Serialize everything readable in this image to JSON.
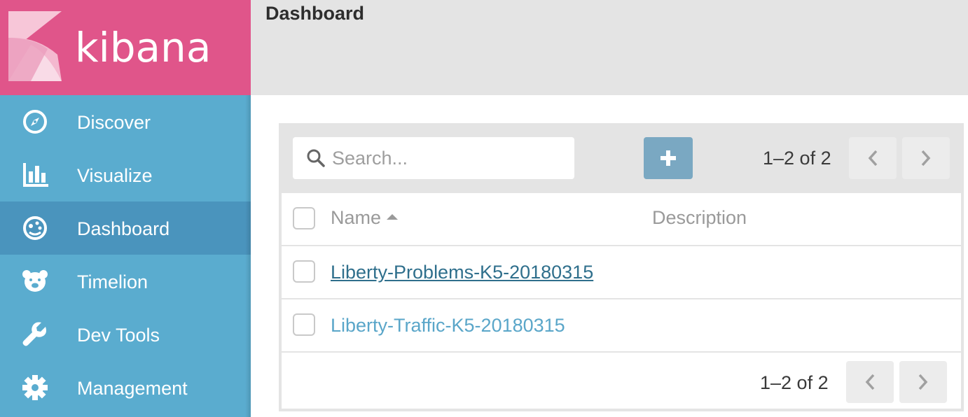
{
  "brand": {
    "name": "kibana"
  },
  "sidebar": {
    "items": [
      {
        "label": "Discover",
        "icon": "compass-icon",
        "active": false
      },
      {
        "label": "Visualize",
        "icon": "bar-chart-icon",
        "active": false
      },
      {
        "label": "Dashboard",
        "icon": "dashboard-gauge-icon",
        "active": true
      },
      {
        "label": "Timelion",
        "icon": "bear-icon",
        "active": false
      },
      {
        "label": "Dev Tools",
        "icon": "wrench-icon",
        "active": false
      },
      {
        "label": "Management",
        "icon": "gear-icon",
        "active": false
      }
    ]
  },
  "header": {
    "title": "Dashboard"
  },
  "toolbar": {
    "search_placeholder": "Search...",
    "add_label": "+",
    "pager_text": "1–2 of 2"
  },
  "table": {
    "columns": {
      "name": "Name",
      "description": "Description"
    },
    "rows": [
      {
        "name": "Liberty-Problems-K5-20180315",
        "description": ""
      },
      {
        "name": "Liberty-Traffic-K5-20180315",
        "description": ""
      }
    ],
    "footer_pager_text": "1–2 of 2"
  },
  "colors": {
    "sidebar": "#5aaccf",
    "sidebar_active": "#4a94bd",
    "logo_bg": "#e0558a",
    "link": "#5aa6c9",
    "link_visited": "#2f6f8c",
    "add_button": "#7aa8c2"
  }
}
